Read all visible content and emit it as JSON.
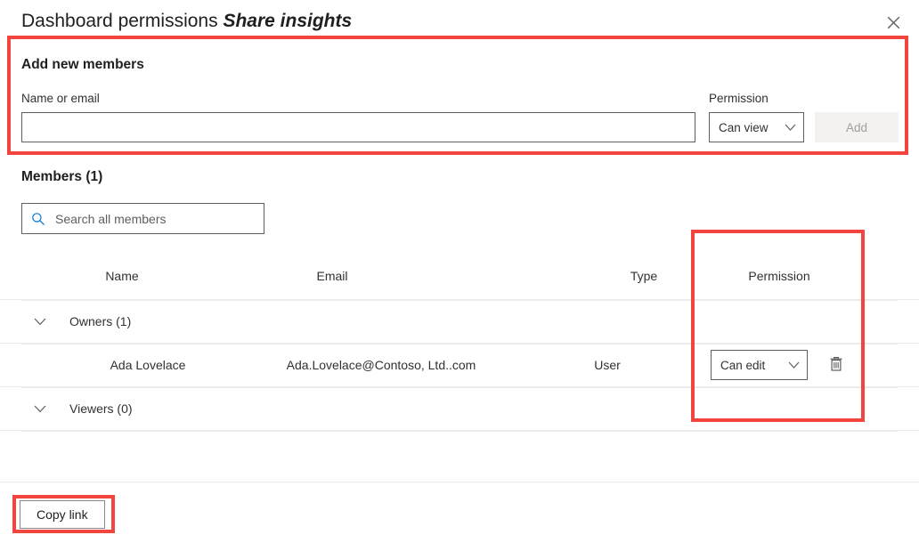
{
  "dialog": {
    "title_main": "Dashboard permissions",
    "title_emphasis": "Share insights",
    "close_icon": "close-icon"
  },
  "add_members": {
    "heading": "Add new members",
    "name_label": "Name or email",
    "name_placeholder": "",
    "name_value": "",
    "permission_label": "Permission",
    "permission_value": "Can view",
    "add_button": "Add",
    "add_button_disabled": true
  },
  "members": {
    "heading": "Members (1)",
    "search_placeholder": "Search all members",
    "search_value": "",
    "search_icon": "search-icon",
    "columns": {
      "name": "Name",
      "email": "Email",
      "type": "Type",
      "permission": "Permission"
    },
    "groups": [
      {
        "label": "Owners (1)",
        "chevron_icon": "chevron-down-icon",
        "rows": [
          {
            "name": "Ada Lovelace",
            "email": "Ada.Lovelace@Contoso, Ltd..com",
            "type": "User",
            "permission": "Can edit",
            "delete_icon": "trash-icon"
          }
        ]
      },
      {
        "label": "Viewers (0)",
        "chevron_icon": "chevron-down-icon",
        "rows": []
      }
    ]
  },
  "footer": {
    "copy_link": "Copy link"
  },
  "annotations": {
    "color": "#f3453f",
    "boxes": [
      {
        "name": "add-new-members-section"
      },
      {
        "name": "permission-column"
      },
      {
        "name": "copy-link-button"
      }
    ]
  }
}
